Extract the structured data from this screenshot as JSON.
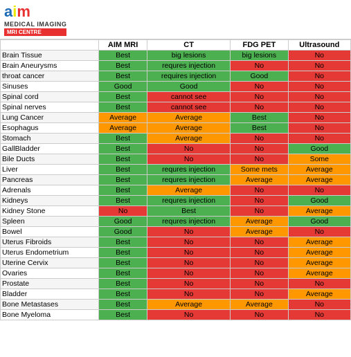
{
  "header": {
    "logo_a": "a",
    "logo_i": "i",
    "logo_m": "m",
    "medical_imaging": "MEDICAL IMAGING",
    "mri_centre": "MRI CENTRE"
  },
  "table": {
    "columns": [
      "",
      "AIM MRI",
      "CT",
      "FDG PET",
      "Ultrasound"
    ],
    "rows": [
      {
        "name": "Brain Tissue",
        "mri": "Best",
        "mri_color": "green",
        "ct": "big lesions",
        "ct_color": "green",
        "pet": "big lesions",
        "pet_color": "green",
        "us": "No",
        "us_color": "red"
      },
      {
        "name": "Brain Aneurysms",
        "mri": "Best",
        "mri_color": "green",
        "ct": "requres injection",
        "ct_color": "green",
        "pet": "No",
        "pet_color": "red",
        "us": "No",
        "us_color": "red"
      },
      {
        "name": "throat cancer",
        "mri": "Best",
        "mri_color": "green",
        "ct": "requires injection",
        "ct_color": "green",
        "pet": "Good",
        "pet_color": "green",
        "us": "No",
        "us_color": "red"
      },
      {
        "name": "Sinuses",
        "mri": "Good",
        "mri_color": "green",
        "ct": "Good",
        "ct_color": "green",
        "pet": "No",
        "pet_color": "red",
        "us": "No",
        "us_color": "red"
      },
      {
        "name": "Spinal cord",
        "mri": "Best",
        "mri_color": "green",
        "ct": "cannot see",
        "ct_color": "red",
        "pet": "No",
        "pet_color": "red",
        "us": "No",
        "us_color": "red"
      },
      {
        "name": "Spinal nerves",
        "mri": "Best",
        "mri_color": "green",
        "ct": "cannot see",
        "ct_color": "red",
        "pet": "No",
        "pet_color": "red",
        "us": "No",
        "us_color": "red"
      },
      {
        "name": "Lung Cancer",
        "mri": "Average",
        "mri_color": "orange",
        "ct": "Average",
        "ct_color": "orange",
        "pet": "Best",
        "pet_color": "green",
        "us": "No",
        "us_color": "red"
      },
      {
        "name": "Esophagus",
        "mri": "Average",
        "mri_color": "orange",
        "ct": "Average",
        "ct_color": "orange",
        "pet": "Best",
        "pet_color": "green",
        "us": "No",
        "us_color": "red"
      },
      {
        "name": "Stomach",
        "mri": "Best",
        "mri_color": "green",
        "ct": "Average",
        "ct_color": "orange",
        "pet": "No",
        "pet_color": "red",
        "us": "No",
        "us_color": "red"
      },
      {
        "name": "GallBladder",
        "mri": "Best",
        "mri_color": "green",
        "ct": "No",
        "ct_color": "red",
        "pet": "No",
        "pet_color": "red",
        "us": "Good",
        "us_color": "green"
      },
      {
        "name": "Bile Ducts",
        "mri": "Best",
        "mri_color": "green",
        "ct": "No",
        "ct_color": "red",
        "pet": "No",
        "pet_color": "red",
        "us": "Some",
        "us_color": "orange"
      },
      {
        "name": "Liver",
        "mri": "Best",
        "mri_color": "green",
        "ct": "requres injection",
        "ct_color": "green",
        "pet": "Some mets",
        "pet_color": "orange",
        "us": "Average",
        "us_color": "orange"
      },
      {
        "name": "Pancreas",
        "mri": "Best",
        "mri_color": "green",
        "ct": "requres injection",
        "ct_color": "green",
        "pet": "Average",
        "pet_color": "orange",
        "us": "Average",
        "us_color": "orange"
      },
      {
        "name": "Adrenals",
        "mri": "Best",
        "mri_color": "green",
        "ct": "Average",
        "ct_color": "orange",
        "pet": "No",
        "pet_color": "red",
        "us": "No",
        "us_color": "red"
      },
      {
        "name": "Kidneys",
        "mri": "Best",
        "mri_color": "green",
        "ct": "requres injection",
        "ct_color": "green",
        "pet": "No",
        "pet_color": "red",
        "us": "Good",
        "us_color": "green"
      },
      {
        "name": "Kidney Stone",
        "mri": "No",
        "mri_color": "red",
        "ct": "Best",
        "ct_color": "green",
        "pet": "No",
        "pet_color": "red",
        "us": "Average",
        "us_color": "orange"
      },
      {
        "name": "Spleen",
        "mri": "Good",
        "mri_color": "green",
        "ct": "requres injection",
        "ct_color": "green",
        "pet": "Average",
        "pet_color": "orange",
        "us": "Good",
        "us_color": "green"
      },
      {
        "name": "Bowel",
        "mri": "Good",
        "mri_color": "green",
        "ct": "No",
        "ct_color": "red",
        "pet": "Average",
        "pet_color": "orange",
        "us": "No",
        "us_color": "red"
      },
      {
        "name": "Uterus Fibroids",
        "mri": "Best",
        "mri_color": "green",
        "ct": "No",
        "ct_color": "red",
        "pet": "No",
        "pet_color": "red",
        "us": "Average",
        "us_color": "orange"
      },
      {
        "name": "Uterus Endometrium",
        "mri": "Best",
        "mri_color": "green",
        "ct": "No",
        "ct_color": "red",
        "pet": "No",
        "pet_color": "red",
        "us": "Average",
        "us_color": "orange"
      },
      {
        "name": "Uterine Cervix",
        "mri": "Best",
        "mri_color": "green",
        "ct": "No",
        "ct_color": "red",
        "pet": "No",
        "pet_color": "red",
        "us": "Average",
        "us_color": "orange"
      },
      {
        "name": "Ovaries",
        "mri": "Best",
        "mri_color": "green",
        "ct": "No",
        "ct_color": "red",
        "pet": "No",
        "pet_color": "red",
        "us": "Average",
        "us_color": "orange"
      },
      {
        "name": "Prostate",
        "mri": "Best",
        "mri_color": "green",
        "ct": "No",
        "ct_color": "red",
        "pet": "No",
        "pet_color": "red",
        "us": "No",
        "us_color": "red"
      },
      {
        "name": "Bladder",
        "mri": "Best",
        "mri_color": "green",
        "ct": "No",
        "ct_color": "red",
        "pet": "No",
        "pet_color": "red",
        "us": "Average",
        "us_color": "orange"
      },
      {
        "name": "Bone Metastases",
        "mri": "Best",
        "mri_color": "green",
        "ct": "Average",
        "ct_color": "orange",
        "pet": "Average",
        "pet_color": "orange",
        "us": "No",
        "us_color": "red"
      },
      {
        "name": "Bone Myeloma",
        "mri": "Best",
        "mri_color": "green",
        "ct": "No",
        "ct_color": "red",
        "pet": "No",
        "pet_color": "red",
        "us": "No",
        "us_color": "red"
      }
    ]
  }
}
